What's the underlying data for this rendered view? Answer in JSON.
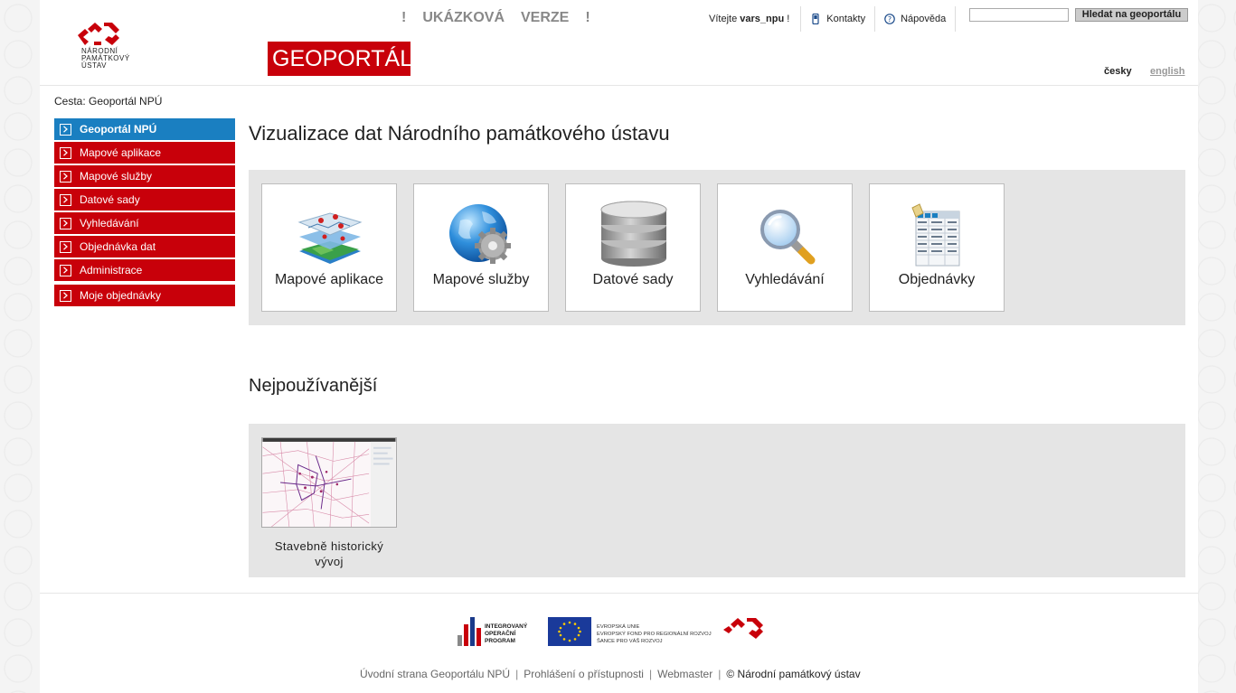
{
  "header": {
    "logo_lines": [
      "NÁRODNÍ",
      "PAMÁTKOVÝ",
      "ÚSTAV"
    ],
    "demo_banner": [
      "!",
      "UKÁZKOVÁ",
      "VERZE",
      "!"
    ],
    "badge": "GEOPORTÁL",
    "welcome_prefix": "Vítejte",
    "username": "vars_npu",
    "welcome_suffix": "!",
    "contacts": "Kontakty",
    "help": "Nápověda",
    "search_value": "",
    "search_button": "Hledat na geoportálu",
    "lang_cs": "česky",
    "lang_en": "english"
  },
  "breadcrumb": "Cesta: Geoportál NPÚ",
  "sidebar": {
    "items": [
      {
        "label": "Geoportál NPÚ",
        "active": true
      },
      {
        "label": "Mapové aplikace"
      },
      {
        "label": "Mapové služby"
      },
      {
        "label": "Datové sady"
      },
      {
        "label": "Vyhledávání"
      },
      {
        "label": "Objednávka dat"
      },
      {
        "label": "Administrace"
      },
      {
        "label": "Moje objednávky"
      }
    ]
  },
  "main": {
    "title": "Vizualizace dat Národního památkového ústavu",
    "tiles": [
      {
        "label": "Mapové aplikace",
        "icon": "map-layers-icon"
      },
      {
        "label": "Mapové služby",
        "icon": "globe-gear-icon"
      },
      {
        "label": "Datové sady",
        "icon": "database-icon"
      },
      {
        "label": "Vyhledávání",
        "icon": "magnifier-icon"
      },
      {
        "label": "Objednávky",
        "icon": "spreadsheet-icon"
      }
    ],
    "popular_title": "Nejpoužívanější",
    "popular": [
      {
        "label": "Stavebně historický vývoj"
      }
    ]
  },
  "footer": {
    "iop_lines": [
      "INTEGROVANÝ",
      "OPERAČNÍ",
      "PROGRAM"
    ],
    "eu_lines": [
      "EVROPSKÁ UNIE",
      "EVROPSKÝ FOND PRO REGIONÁLNÍ ROZVOJ",
      "ŠANCE PRO VÁŠ ROZVOJ"
    ],
    "links": [
      "Úvodní strana Geoportálu NPÚ",
      "Prohlášení o přístupnosti",
      "Webmaster"
    ],
    "copyright": "© Národní památkový ústav"
  },
  "colors": {
    "brand_red": "#c8000a",
    "active_blue": "#1a7fc1",
    "panel_gray": "#e5e5e5"
  }
}
